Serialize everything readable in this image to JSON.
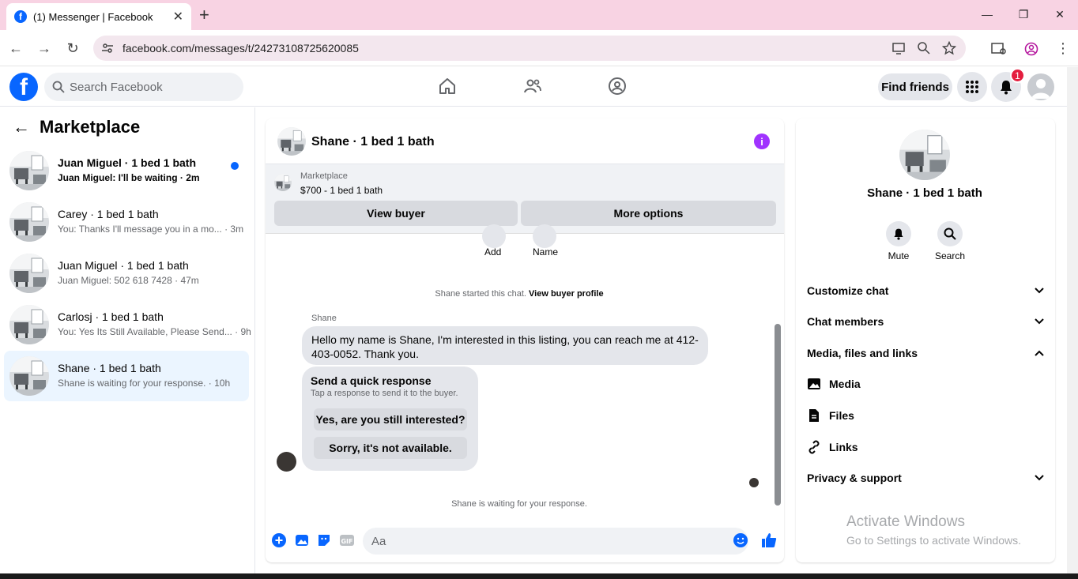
{
  "browser": {
    "tab_title": "(1) Messenger | Facebook",
    "url": "facebook.com/messages/t/24273108725620085"
  },
  "header": {
    "search_placeholder": "Search Facebook",
    "find_friends": "Find friends",
    "notification_count": "1"
  },
  "sidebar": {
    "title": "Marketplace",
    "conversations": [
      {
        "name": "Juan Miguel · 1 bed 1 bath",
        "preview": "Juan Miguel: I'll be waiting · 2m",
        "unread": true
      },
      {
        "name": "Carey · 1 bed 1 bath",
        "preview": "You: Thanks I'll message you in a mo... · 3m"
      },
      {
        "name": "Juan Miguel · 1 bed 1 bath",
        "preview": "Juan Miguel: 502 618 7428 · 47m"
      },
      {
        "name": "Carlosj · 1 bed 1 bath",
        "preview": "You: Yes Its Still Available, Please Send... · 9h"
      },
      {
        "name": "Shane · 1 bed 1 bath",
        "preview": "Shane is waiting for your response. · 10h",
        "active": true
      }
    ]
  },
  "chat": {
    "title": "Shane · 1 bed 1 bath",
    "marketplace_label": "Marketplace",
    "listing": "$700 - 1 bed 1 bath",
    "view_buyer": "View buyer",
    "more_options": "More options",
    "actions": [
      "Add",
      "Name"
    ],
    "started_text": "Shane started this chat.",
    "view_profile": "View buyer profile",
    "sender": "Shane",
    "message": "Hello my name is Shane, I'm interested in this listing, you can reach me at 412-403-0052. Thank you.",
    "quick_title": "Send a quick response",
    "quick_sub": "Tap a response to send it to the buyer.",
    "quick_options": [
      "Yes, are you still interested?",
      "Sorry, it's not available."
    ],
    "waiting": "Shane is waiting for your response.",
    "input_placeholder": "Aa"
  },
  "details": {
    "title": "Shane · 1 bed 1 bath",
    "mute": "Mute",
    "search": "Search",
    "sections": [
      "Customize chat",
      "Chat members",
      "Media, files and links"
    ],
    "media_items": [
      "Media",
      "Files",
      "Links"
    ],
    "privacy": "Privacy & support"
  },
  "watermark": {
    "line1": "Activate Windows",
    "line2": "Go to Settings to activate Windows."
  },
  "colors": {
    "brand": "#0866ff",
    "accent_purple": "#a033ff",
    "tab_bar": "#f8d3e3"
  }
}
